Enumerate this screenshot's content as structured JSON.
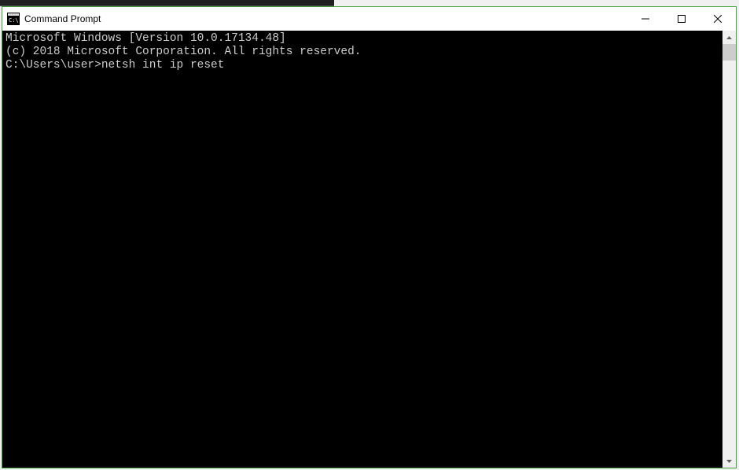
{
  "window": {
    "title": "Command Prompt"
  },
  "terminal": {
    "lines": [
      "Microsoft Windows [Version 10.0.17134.48]",
      "(c) 2018 Microsoft Corporation. All rights reserved.",
      ""
    ],
    "prompt": "C:\\Users\\user>",
    "command": "netsh int ip reset"
  },
  "colors": {
    "terminal_bg": "#000000",
    "terminal_fg": "#cccccc",
    "titlebar_bg": "#ffffff",
    "window_border": "#3a9d3a"
  }
}
